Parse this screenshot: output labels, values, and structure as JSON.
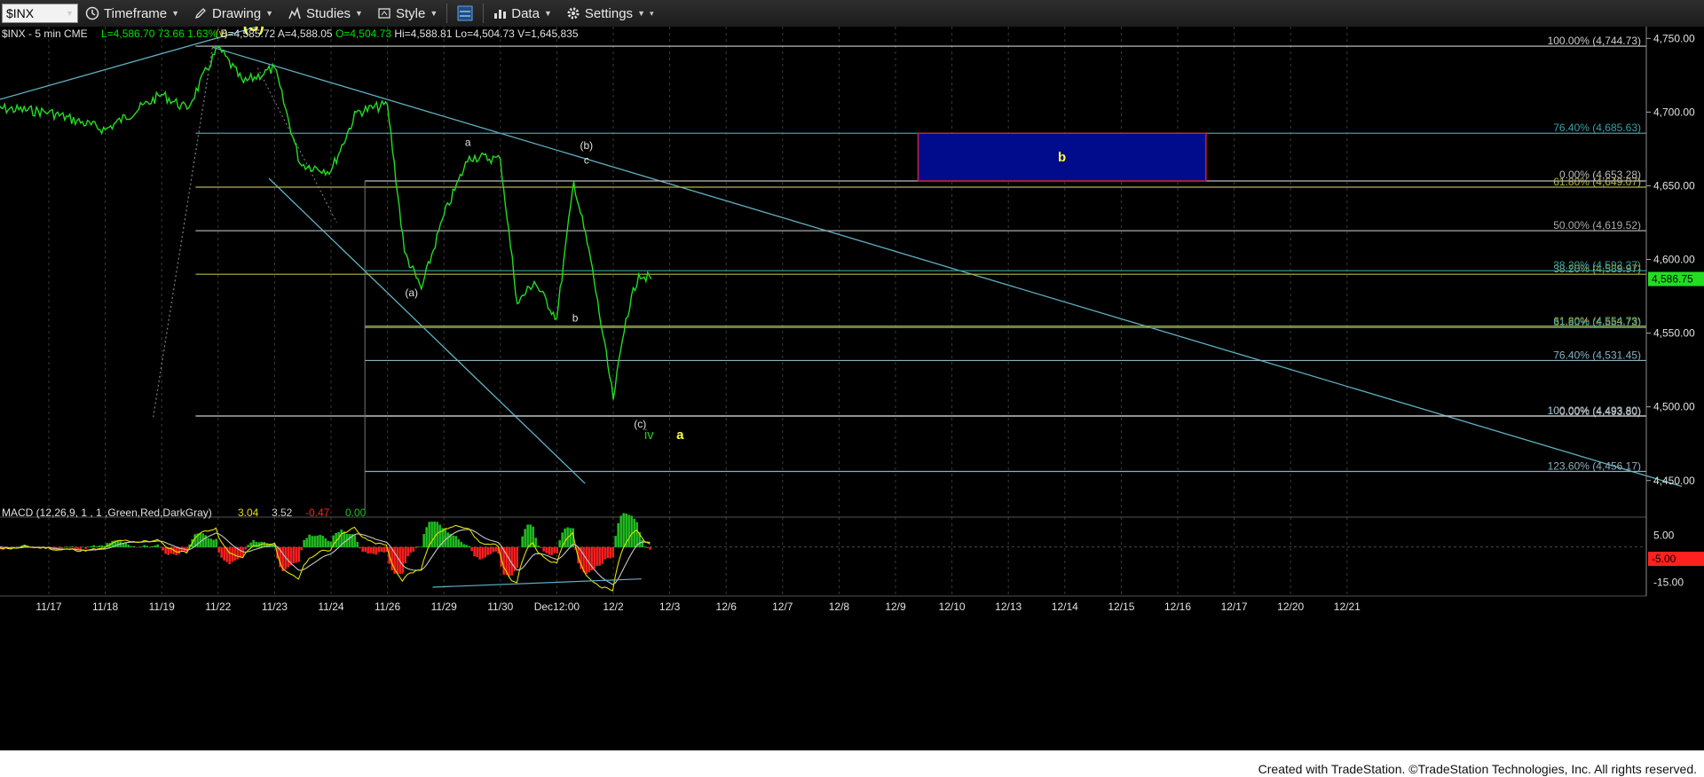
{
  "toolbar": {
    "symbol": "$INX",
    "timeframe_label": "Timeframe",
    "drawing_label": "Drawing",
    "studies_label": "Studies",
    "style_label": "Style",
    "data_label": "Data",
    "settings_label": "Settings"
  },
  "header": {
    "symbol_info": "$INX - 5 min  CME",
    "stats": [
      {
        "text": "L=4,586.70",
        "color": "#00e000"
      },
      {
        "text": "73.66",
        "color": "#00e000"
      },
      {
        "text": "1.63%",
        "color": "#00e000"
      },
      {
        "text": "B=4,585.72",
        "color": "#e0e0e0"
      },
      {
        "text": "A=4,588.05",
        "color": "#e0e0e0"
      },
      {
        "text": "O=4,504.73",
        "color": "#00e000"
      },
      {
        "text": "Hi=4,588.81",
        "color": "#e0e0e0"
      },
      {
        "text": "Lo=4,504.73",
        "color": "#e0e0e0"
      },
      {
        "text": "V=1,645,835",
        "color": "#e0e0e0"
      }
    ]
  },
  "chart_data": {
    "type": "line",
    "series": [
      {
        "name": "$INX - 5 min",
        "color": "#22dd22",
        "x": [
          "11/16",
          "11/17",
          "11/18",
          "11/19",
          "11/19",
          "11/22",
          "11/22",
          "11/23",
          "11/23",
          "11/24",
          "11/24",
          "11/26",
          "11/26",
          "11/26",
          "11/29",
          "11/29",
          "11/30",
          "11/30",
          "11/30",
          "Dec12:00",
          "Dec12:00",
          "Dec12:00",
          "12/2",
          "12/2",
          "12/2",
          "12/2"
        ],
        "y": [
          4703,
          4700,
          4688,
          4712,
          4702,
          4744,
          4720,
          4730,
          4665,
          4660,
          4700,
          4705,
          4605,
          4580,
          4630,
          4670,
          4668,
          4570,
          4585,
          4560,
          4653,
          4600,
          4505,
          4560,
          4590,
          4586.75
        ]
      }
    ],
    "x_ticks": [
      "11/17",
      "11/18",
      "11/19",
      "11/22",
      "11/23",
      "11/24",
      "11/26",
      "11/29",
      "11/30",
      "Dec12:00",
      "12/2",
      "12/3",
      "12/6",
      "12/7",
      "12/8",
      "12/9",
      "12/10",
      "12/13",
      "12/14",
      "12/15",
      "12/16",
      "12/17",
      "12/20",
      "12/21"
    ],
    "y_ticks": [
      "4,750.00",
      "4,700.00",
      "4,650.00",
      "4,600.00",
      "4,550.00",
      "4,500.00",
      "4,450.00"
    ],
    "ylim": [
      4430,
      4758
    ],
    "last_price": "4,586.75",
    "fib_levels": [
      {
        "label": "100.00% (4,744.73)",
        "price": 4744.73,
        "color": "#cccccc"
      },
      {
        "label": "76.40% (4,685.63)",
        "price": 4685.63,
        "color": "#3aa0a0"
      },
      {
        "label": "61.80% (4,649.07)",
        "price": 4649.07,
        "color": "#b5b545"
      },
      {
        "label": "50.00% (4,619.52)",
        "price": 4619.52,
        "color": "#aaaaaa"
      },
      {
        "label": "38.20% (4,589.97)",
        "price": 4589.97,
        "color": "#b5b545"
      },
      {
        "label": "100.00% (4,493.80)",
        "price": 4493.8,
        "color": "#cccccc"
      },
      {
        "label": "0.00% (4,653.28)",
        "price": 4653.28,
        "color": "#bbbbbb"
      },
      {
        "label": "38.20% (4,592.37)",
        "price": 4592.37,
        "color": "#3aa0a0"
      },
      {
        "label": "61.80% (4,554.73)",
        "price": 4554.73,
        "color": "#b5b545"
      },
      {
        "label": "61.80% (4,553.73)",
        "price": 4553.73,
        "color": "#3aa0a0"
      },
      {
        "label": "76.40% (4,531.45)",
        "price": 4531.45,
        "color": "#8ab0c0"
      },
      {
        "label": "100.00% (4,493.80)",
        "price": 4493.8,
        "color": "#8ab0c0"
      },
      {
        "label": "0.00% (4,493.80)",
        "price": 4493.8,
        "color": "#bbbbbb"
      },
      {
        "label": "123.60% (4,456.17)",
        "price": 4456.17,
        "color": "#8ab0c0"
      }
    ],
    "target_box": {
      "label": "b",
      "price_top": 4685.63,
      "price_bottom": 4653.28,
      "from": "12/9",
      "to": "12/16",
      "fill": "#000c8c",
      "border": "#cc2233"
    },
    "wave_labels": [
      {
        "text": "iii",
        "x": "11/22",
        "price": 4760,
        "color": "#c8c800"
      },
      {
        "text": "(v)",
        "x": "11/22",
        "price": 4751,
        "color": "#c8c800"
      },
      {
        "text": "(3)",
        "x": "11/22",
        "price": 4755,
        "color": "#ffff44"
      },
      {
        "text": "a",
        "x": "11/29",
        "price": 4677,
        "color": "#e0e0e0"
      },
      {
        "text": "(b)",
        "x": "Dec12:00",
        "price": 4675,
        "color": "#e0e0e0"
      },
      {
        "text": "c",
        "x": "Dec12:00",
        "price": 4665,
        "color": "#e0e0e0"
      },
      {
        "text": "(a)",
        "x": "11/26",
        "price": 4575,
        "color": "#e0e0e0"
      },
      {
        "text": "b",
        "x": "Dec12:00",
        "price": 4558,
        "color": "#e0e0e0"
      },
      {
        "text": "(c)",
        "x": "12/2",
        "price": 4486,
        "color": "#e0e0e0"
      },
      {
        "text": "iv",
        "x": "12/2",
        "price": 4478,
        "color": "#22cc22"
      },
      {
        "text": "a",
        "x": "12/2",
        "price": 4478,
        "color": "#ffff44"
      }
    ],
    "macd": {
      "label": "MACD (12,26,9, 1 , 1 ,Green,Red,DarkGray)",
      "values": [
        {
          "text": "3.04",
          "color": "#e0e000"
        },
        {
          "text": "3.52",
          "color": "#d0d0d0"
        },
        {
          "text": "-0.47",
          "color": "#ff2020"
        },
        {
          "text": "0.00",
          "color": "#20c020"
        }
      ],
      "y_ticks": [
        "5.00",
        "-15.00"
      ],
      "last_value": "-5.00",
      "ylim": [
        -20,
        10
      ]
    }
  },
  "footer": {
    "credit": "Created with TradeStation. ©TradeStation Technologies, Inc. All rights reserved."
  }
}
